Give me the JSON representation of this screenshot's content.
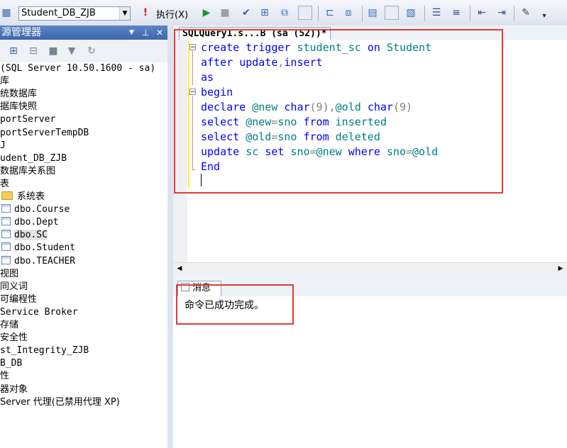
{
  "toolbar": {
    "database": "Student_DB_ZJB",
    "execute_label": "执行(X)"
  },
  "object_explorer": {
    "title": "源管理器",
    "tree": [
      {
        "text": " (SQL Server 10.50.1600 - sa)",
        "mono": true
      },
      {
        "text": "库"
      },
      {
        "text": "统数据库"
      },
      {
        "text": "据库快照"
      },
      {
        "text": "portServer",
        "mono": true
      },
      {
        "text": "portServerTempDB",
        "mono": true
      },
      {
        "text": "J",
        "mono": true
      },
      {
        "text": "udent_DB_ZJB",
        "mono": true
      },
      {
        "text": " 数据库关系图"
      },
      {
        "text": " 表"
      },
      {
        "text": "系统表",
        "icon": "folder"
      },
      {
        "text": "dbo.Course",
        "icon": "table",
        "mono": true
      },
      {
        "text": "dbo.Dept",
        "icon": "table",
        "mono": true
      },
      {
        "text": "dbo.SC",
        "icon": "table",
        "mono": true,
        "selected": true
      },
      {
        "text": "dbo.Student",
        "icon": "table",
        "mono": true
      },
      {
        "text": "dbo.TEACHER",
        "icon": "table",
        "mono": true
      },
      {
        "text": " 视图"
      },
      {
        "text": " 同义词"
      },
      {
        "text": " 可编程性"
      },
      {
        "text": " Service Broker",
        "mono": true
      },
      {
        "text": " 存储"
      },
      {
        "text": " 安全性"
      },
      {
        "text": "st_Integrity_ZJB",
        "mono": true
      },
      {
        "text": "B_DB",
        "mono": true
      },
      {
        "text": "性"
      },
      {
        "text": "器对象"
      },
      {
        "text": "Server 代理(已禁用代理 XP)"
      }
    ]
  },
  "editor": {
    "tab_title": "SQLQuery1.s...B (sa (52))*",
    "lines": [
      [
        {
          "t": "create",
          "c": "kw"
        },
        {
          "t": " ",
          "c": "pl"
        },
        {
          "t": "trigger",
          "c": "kw"
        },
        {
          "t": " student_sc ",
          "c": "id"
        },
        {
          "t": "on",
          "c": "kw"
        },
        {
          "t": " Student",
          "c": "id"
        }
      ],
      [
        {
          "t": "after",
          "c": "kw"
        },
        {
          "t": " ",
          "c": "pl"
        },
        {
          "t": "update",
          "c": "kw"
        },
        {
          "t": ",",
          "c": "gr"
        },
        {
          "t": "insert",
          "c": "kw"
        }
      ],
      [
        {
          "t": "as",
          "c": "kw"
        }
      ],
      [
        {
          "t": "begin",
          "c": "kw"
        }
      ],
      [
        {
          "t": "declare",
          "c": "kw"
        },
        {
          "t": " @new ",
          "c": "id"
        },
        {
          "t": "char",
          "c": "kw"
        },
        {
          "t": "(9)",
          "c": "gr"
        },
        {
          "t": ",",
          "c": "gr"
        },
        {
          "t": "@old ",
          "c": "id"
        },
        {
          "t": "char",
          "c": "kw"
        },
        {
          "t": "(9)",
          "c": "gr"
        }
      ],
      [
        {
          "t": "select",
          "c": "kw"
        },
        {
          "t": " @new",
          "c": "id"
        },
        {
          "t": "=",
          "c": "gr"
        },
        {
          "t": "sno ",
          "c": "id"
        },
        {
          "t": "from",
          "c": "kw"
        },
        {
          "t": " inserted",
          "c": "id"
        }
      ],
      [
        {
          "t": "select",
          "c": "kw"
        },
        {
          "t": " @old",
          "c": "id"
        },
        {
          "t": "=",
          "c": "gr"
        },
        {
          "t": "sno ",
          "c": "id"
        },
        {
          "t": "from",
          "c": "kw"
        },
        {
          "t": " deleted",
          "c": "id"
        }
      ],
      [
        {
          "t": "update",
          "c": "kw"
        },
        {
          "t": " sc ",
          "c": "id"
        },
        {
          "t": "set",
          "c": "kw"
        },
        {
          "t": " sno",
          "c": "id"
        },
        {
          "t": "=",
          "c": "gr"
        },
        {
          "t": "@new ",
          "c": "id"
        },
        {
          "t": "where",
          "c": "kw"
        },
        {
          "t": " sno",
          "c": "id"
        },
        {
          "t": "=",
          "c": "gr"
        },
        {
          "t": "@old",
          "c": "id"
        }
      ],
      [
        {
          "t": "End",
          "c": "kw"
        }
      ]
    ]
  },
  "results": {
    "tab_label": "消息",
    "message": "命令已成功完成。"
  },
  "colors": {
    "keyword": "#0000ff",
    "identifier": "#008080",
    "annotation_box": "#e23a3a"
  }
}
